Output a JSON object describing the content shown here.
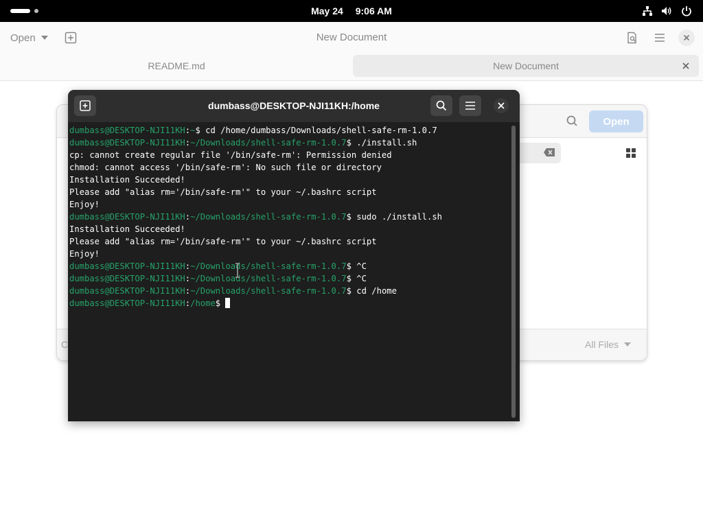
{
  "topbar": {
    "date": "May 24",
    "time": "9:06 AM",
    "icons": [
      "network-icon",
      "volume-icon",
      "power-icon"
    ]
  },
  "gedit": {
    "open_label": "Open",
    "title": "New Document",
    "tabs": [
      {
        "label": "README.md",
        "active": false
      },
      {
        "label": "New Document",
        "active": true
      }
    ]
  },
  "chooser": {
    "open_label": "Open",
    "filter_label": "All Files",
    "footer_left": "C"
  },
  "terminal": {
    "title": "dumbass@DESKTOP-NJI11KH:/home",
    "lines": [
      {
        "user": "dumbass@DESKTOP-NJI11KH",
        "path": "~",
        "cmd": "$ cd /home/dumbass/Downloads/shell-safe-rm-1.0.7"
      },
      {
        "user": "dumbass@DESKTOP-NJI11KH",
        "path": "~/Downloads/shell-safe-rm-1.0.7",
        "cmd": "$ ./install.sh"
      },
      {
        "text": "cp: cannot create regular file '/bin/safe-rm': Permission denied"
      },
      {
        "text": "chmod: cannot access '/bin/safe-rm': No such file or directory"
      },
      {
        "text": "Installation Succeeded!"
      },
      {
        "text": "Please add \"alias rm='/bin/safe-rm'\" to your ~/.bashrc script"
      },
      {
        "text": "Enjoy!"
      },
      {
        "user": "dumbass@DESKTOP-NJI11KH",
        "path": "~/Downloads/shell-safe-rm-1.0.7",
        "cmd": "$ sudo ./install.sh"
      },
      {
        "text": "Installation Succeeded!"
      },
      {
        "text": "Please add \"alias rm='/bin/safe-rm'\" to your ~/.bashrc script"
      },
      {
        "text": "Enjoy!"
      },
      {
        "user": "dumbass@DESKTOP-NJI11KH",
        "path": "~/Downloads/shell-safe-rm-1.0.7",
        "cmd": "$ ^C"
      },
      {
        "user": "dumbass@DESKTOP-NJI11KH",
        "path": "~/Downloads/shell-safe-rm-1.0.7",
        "cmd": "$ ^C"
      },
      {
        "user": "dumbass@DESKTOP-NJI11KH",
        "path": "~/Downloads/shell-safe-rm-1.0.7",
        "cmd": "$ cd /home"
      },
      {
        "user": "dumbass@DESKTOP-NJI11KH",
        "path": "/home",
        "cmd": "$ "
      }
    ]
  },
  "colors": {
    "prompt_user": "#26a269",
    "prompt_path": "#26a269",
    "terminal_bg": "#1e1e1e",
    "header_bg": "#2e2e2e"
  }
}
